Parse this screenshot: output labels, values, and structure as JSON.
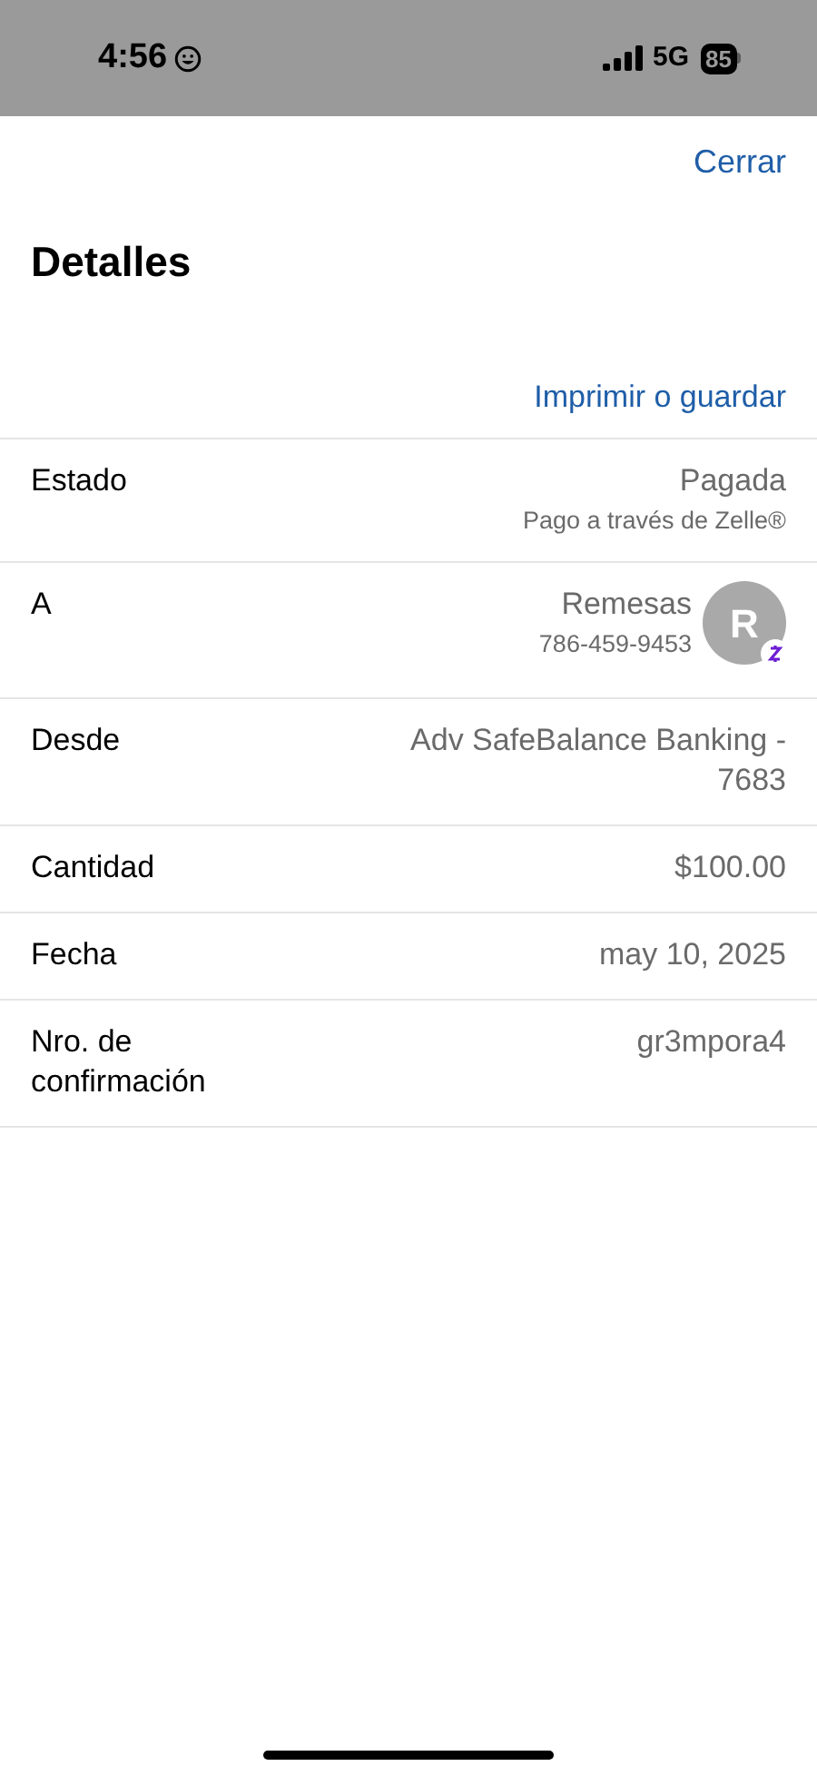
{
  "status_bar": {
    "time": "4:56",
    "network": "5G",
    "battery": "85"
  },
  "close_button": "Cerrar",
  "title": "Detalles",
  "print_link": "Imprimir o guardar",
  "rows": [
    {
      "kind": "status",
      "label": "Estado",
      "value": "Pagada",
      "note": "Pago a través de Zelle®"
    },
    {
      "kind": "contact",
      "label": "A",
      "value": "Remesas",
      "note": "786-459-9453",
      "initial": "R"
    },
    {
      "kind": "plain",
      "label": "Desde",
      "value": "Adv SafeBalance Banking - 7683"
    },
    {
      "kind": "plain",
      "label": "Cantidad",
      "value": "$100.00"
    },
    {
      "kind": "plain",
      "label": "Fecha",
      "value": "may 10, 2025"
    },
    {
      "kind": "plain",
      "label": "Nro. de confirmación",
      "value": "gr3mpora4"
    }
  ]
}
